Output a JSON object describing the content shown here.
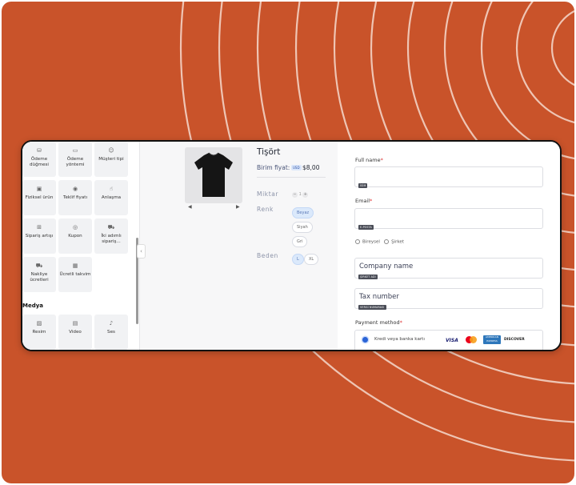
{
  "colors": {
    "background": "#c9532a",
    "accent": "#2a63d6",
    "chip_selected": "#dbe9fb"
  },
  "palette": {
    "tiles": [
      {
        "label": "Ödeme düğmesi",
        "icon": "money-icon"
      },
      {
        "label": "Ödeme yöntemi",
        "icon": "card-icon"
      },
      {
        "label": "Müşteri tipi",
        "icon": "user-icon"
      },
      {
        "label": "Fiziksel ürün",
        "icon": "box-icon"
      },
      {
        "label": "Teklif fiyatı",
        "icon": "tag-icon"
      },
      {
        "label": "Anlaşma",
        "icon": "handshake-icon"
      },
      {
        "label": "Sipariş artışı",
        "icon": "cart-plus-icon"
      },
      {
        "label": "Kupon",
        "icon": "coupon-icon"
      },
      {
        "label": "İki adımlı sipariş...",
        "icon": "cart-icon"
      },
      {
        "label": "Nakliye ücretleri",
        "icon": "truck-icon"
      },
      {
        "label": "Ücretli takvim",
        "icon": "calendar-icon"
      }
    ],
    "media_title": "Medya",
    "media_tiles": [
      {
        "label": "Resim",
        "icon": "image-icon"
      },
      {
        "label": "Video",
        "icon": "video-icon"
      },
      {
        "label": "Ses",
        "icon": "audio-icon"
      }
    ]
  },
  "product": {
    "title": "Tişört",
    "price_label": "Birim fiyat:",
    "currency_badge": "USD",
    "price": "$8,00",
    "quantity_label": "Miktar",
    "quantity": "1",
    "color_label": "Renk",
    "colors": [
      "Beyaz",
      "Siyah",
      "Gri"
    ],
    "size_label": "Beden",
    "sizes": [
      "L",
      "XL"
    ]
  },
  "form": {
    "full_name_label": "Full name",
    "full_name_tag": "İSİM",
    "email_label": "Email",
    "email_tag": "E-POSTA",
    "customer_types": [
      "Bireysel",
      "Şirket"
    ],
    "company_placeholder": "Company name",
    "company_tag": "ŞİRKET ADI",
    "tax_placeholder": "Tax number",
    "tax_tag": "VERGİ NUMARASI",
    "payment_label": "Payment method",
    "required_mark": "*",
    "payment_option": "Kredi veya banka kartı",
    "card_brands": {
      "visa": "VISA",
      "amex": "AMERICAN EXPRESS",
      "discover": "DISCOVER"
    }
  }
}
